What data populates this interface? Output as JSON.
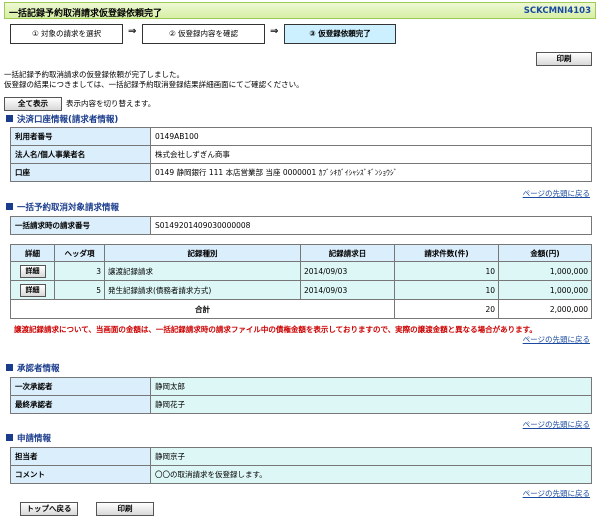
{
  "header": {
    "title": "一括記録予約取消請求仮登録依頼完了",
    "screen_id": "SCKCMNI4103"
  },
  "steps": [
    {
      "label": "① 対象の請求を選択"
    },
    {
      "label": "② 仮登録内容を確認"
    },
    {
      "label": "③ 仮登録依頼完了"
    }
  ],
  "arrow": "⇒",
  "buttons": {
    "print": "印刷",
    "show_all": "全て表示",
    "back_top": "トップへ戻る",
    "print_bottom": "印刷"
  },
  "messages": {
    "line1": "一括記録予約取消請求の仮登録依頼が完了しました。",
    "line2": "仮登録の結果につきましては、一括記録予約取消登録結果詳細画面にてご確認ください。",
    "toggle_hint": "表示内容を切り替えます。"
  },
  "settlement": {
    "heading": "決済口座情報(請求者情報)",
    "rows": [
      {
        "label": "利用者番号",
        "value": "0149AB100"
      },
      {
        "label": "法人名/個人事業者名",
        "value": "株式会社しずぎん商事"
      },
      {
        "label": "口座",
        "value": "0149 静岡銀行 111 本店営業部 当座 0000001 ｶﾌﾞｼｷｶﾞｲｼｬｼｽﾞｷﾞﾝｼｮｳｼﾞ"
      }
    ]
  },
  "page_top": "ページの先頭に戻る",
  "target": {
    "heading": "一括予約取消対象請求情報",
    "request_no_label": "一括請求時の請求番号",
    "request_no": "S0149201409030000008",
    "columns": [
      "詳細",
      "ヘッダ項",
      "記録種別",
      "記録請求日",
      "請求件数(件)",
      "金額(円)"
    ],
    "rows": [
      {
        "detail": "詳細",
        "header_no": "3",
        "type": "譲渡記録請求",
        "date": "2014/09/03",
        "count": "10",
        "amount": "1,000,000"
      },
      {
        "detail": "詳細",
        "header_no": "5",
        "type": "発生記録請求(債務者請求方式)",
        "date": "2014/09/03",
        "count": "10",
        "amount": "1,000,000"
      }
    ],
    "total_label": "合計",
    "total_count": "20",
    "total_amount": "2,000,000",
    "warning": "譲渡記録請求について、当画面の金額は、一括記録請求時の請求ファイル中の債権金額を表示しておりますので、実際の譲渡金額と異なる場合があります。"
  },
  "approver": {
    "heading": "承認者情報",
    "rows": [
      {
        "label": "一次承認者",
        "value": "静岡太郎"
      },
      {
        "label": "最終承認者",
        "value": "静岡花子"
      }
    ]
  },
  "application": {
    "heading": "申請情報",
    "rows": [
      {
        "label": "担当者",
        "value": "静岡京子"
      },
      {
        "label": "コメント",
        "value": "〇〇の取消請求を仮登録します。"
      }
    ]
  }
}
